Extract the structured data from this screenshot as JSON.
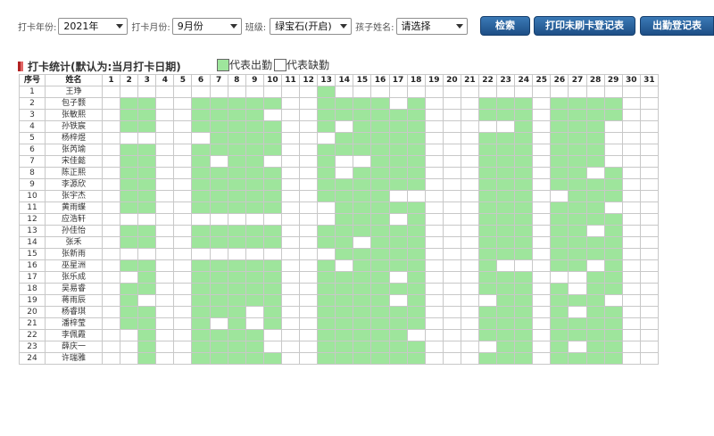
{
  "filters": {
    "year": {
      "label": "打卡年份:",
      "value": "2021年"
    },
    "month": {
      "label": "打卡月份:",
      "value": "9月份"
    },
    "class": {
      "label": "班级:",
      "value": "绿宝石(开启)"
    },
    "child": {
      "label": "孩子姓名:",
      "value": "请选择"
    }
  },
  "buttons": {
    "search": "检索",
    "print_unswiped": "打印未刷卡登记表",
    "attendance_register": "出勤登记表"
  },
  "section": {
    "title": "打卡统计(默认为:当月打卡日期)",
    "legend_present": "代表出勤",
    "legend_absent": "代表缺勤",
    "mark_colors": [
      "#b22222",
      "#e06666"
    ]
  },
  "colors": {
    "present": "#9ee59c",
    "absent": "#ffffff",
    "button": "#2a5f98"
  },
  "table": {
    "headers": {
      "index": "序号",
      "name": "姓名"
    },
    "days": [
      "1",
      "2",
      "3",
      "4",
      "5",
      "6",
      "7",
      "8",
      "9",
      "10",
      "11",
      "12",
      "13",
      "14",
      "15",
      "16",
      "17",
      "18",
      "19",
      "20",
      "21",
      "22",
      "23",
      "24",
      "25",
      "26",
      "27",
      "28",
      "29",
      "30",
      "31"
    ],
    "rows": [
      {
        "index": "1",
        "name": "王琤",
        "present": [
          13
        ]
      },
      {
        "index": "2",
        "name": "包子颢",
        "present": [
          2,
          3,
          6,
          7,
          8,
          9,
          10,
          13,
          14,
          15,
          16,
          18,
          22,
          23,
          24,
          26,
          27,
          28,
          29
        ]
      },
      {
        "index": "3",
        "name": "张敏熙",
        "present": [
          2,
          3,
          6,
          7,
          8,
          9,
          13,
          14,
          15,
          16,
          17,
          18,
          22,
          23,
          24,
          26,
          27,
          28,
          29
        ]
      },
      {
        "index": "4",
        "name": "孙铁宸",
        "present": [
          2,
          3,
          6,
          7,
          8,
          9,
          10,
          13,
          15,
          16,
          17,
          18,
          24,
          26,
          27,
          28
        ]
      },
      {
        "index": "5",
        "name": "杨梓煜",
        "present": [
          7,
          8,
          9,
          10,
          14,
          15,
          16,
          17,
          18,
          22,
          23,
          24,
          26,
          27,
          28
        ]
      },
      {
        "index": "6",
        "name": "张芮瑜",
        "present": [
          2,
          3,
          6,
          7,
          8,
          9,
          10,
          13,
          14,
          15,
          16,
          17,
          18,
          22,
          23,
          24,
          26,
          27,
          28
        ]
      },
      {
        "index": "7",
        "name": "宋佳懿",
        "present": [
          2,
          3,
          6,
          8,
          9,
          13,
          16,
          17,
          18,
          22,
          23,
          24,
          26,
          27,
          28
        ]
      },
      {
        "index": "8",
        "name": "陈正熙",
        "present": [
          2,
          3,
          6,
          7,
          8,
          9,
          10,
          13,
          15,
          16,
          17,
          18,
          22,
          23,
          24,
          26,
          27,
          29
        ]
      },
      {
        "index": "9",
        "name": "李源欣",
        "present": [
          2,
          3,
          6,
          7,
          8,
          9,
          10,
          13,
          14,
          15,
          16,
          17,
          18,
          22,
          23,
          24,
          26,
          27,
          28,
          29
        ]
      },
      {
        "index": "10",
        "name": "张宇杰",
        "present": [
          2,
          3,
          6,
          7,
          8,
          9,
          10,
          13,
          14,
          15,
          16,
          22,
          23,
          24,
          27,
          28,
          29
        ]
      },
      {
        "index": "11",
        "name": "黄雨蝶",
        "present": [
          2,
          3,
          6,
          7,
          8,
          9,
          10,
          14,
          15,
          16,
          17,
          18,
          22,
          23,
          24,
          26,
          27,
          28
        ]
      },
      {
        "index": "12",
        "name": "应浩轩",
        "present": [
          14,
          15,
          16,
          18,
          22,
          23,
          24,
          26,
          27,
          28,
          29
        ]
      },
      {
        "index": "13",
        "name": "孙佳怡",
        "present": [
          2,
          3,
          6,
          7,
          8,
          9,
          10,
          13,
          14,
          15,
          16,
          17,
          18,
          22,
          23,
          24,
          26,
          27,
          29
        ]
      },
      {
        "index": "14",
        "name": "张禾",
        "present": [
          2,
          3,
          6,
          7,
          8,
          9,
          10,
          13,
          14,
          16,
          17,
          18,
          22,
          23,
          24,
          26,
          27,
          28,
          29
        ]
      },
      {
        "index": "15",
        "name": "张新雨",
        "present": [
          14,
          15,
          16,
          17,
          18,
          22,
          23,
          24,
          26,
          27,
          28,
          29
        ]
      },
      {
        "index": "16",
        "name": "巫星洲",
        "present": [
          2,
          3,
          6,
          7,
          8,
          9,
          10,
          13,
          15,
          16,
          17,
          18,
          22,
          26,
          27,
          29
        ]
      },
      {
        "index": "17",
        "name": "张乐成",
        "present": [
          3,
          6,
          7,
          8,
          9,
          10,
          13,
          14,
          15,
          16,
          18,
          22,
          23,
          24,
          28,
          29
        ]
      },
      {
        "index": "18",
        "name": "吴易睿",
        "present": [
          2,
          3,
          6,
          7,
          8,
          9,
          10,
          13,
          14,
          15,
          16,
          17,
          18,
          22,
          23,
          24,
          26,
          28,
          29
        ]
      },
      {
        "index": "19",
        "name": "蒋雨辰",
        "present": [
          2,
          6,
          7,
          8,
          9,
          10,
          13,
          14,
          15,
          16,
          18,
          23,
          24,
          26,
          27,
          28
        ]
      },
      {
        "index": "20",
        "name": "杨睿琪",
        "present": [
          2,
          3,
          6,
          7,
          8,
          10,
          13,
          14,
          15,
          16,
          17,
          18,
          22,
          23,
          24,
          26,
          28,
          29
        ]
      },
      {
        "index": "21",
        "name": "潘梓莹",
        "present": [
          2,
          3,
          6,
          8,
          10,
          13,
          14,
          15,
          16,
          17,
          18,
          22,
          23,
          24,
          26,
          27,
          28,
          29
        ]
      },
      {
        "index": "22",
        "name": "李佩霞",
        "present": [
          3,
          6,
          7,
          8,
          9,
          13,
          14,
          15,
          16,
          17,
          22,
          23,
          24,
          26,
          27,
          28,
          29
        ]
      },
      {
        "index": "23",
        "name": "薛庆一",
        "present": [
          3,
          6,
          7,
          8,
          9,
          13,
          14,
          15,
          16,
          17,
          18,
          23,
          24,
          26,
          28,
          29
        ]
      },
      {
        "index": "24",
        "name": "许瑞雅",
        "present": [
          3,
          6,
          7,
          8,
          9,
          10,
          13,
          14,
          15,
          16,
          17,
          18,
          22,
          23,
          24,
          26,
          27,
          28,
          29
        ]
      }
    ]
  }
}
